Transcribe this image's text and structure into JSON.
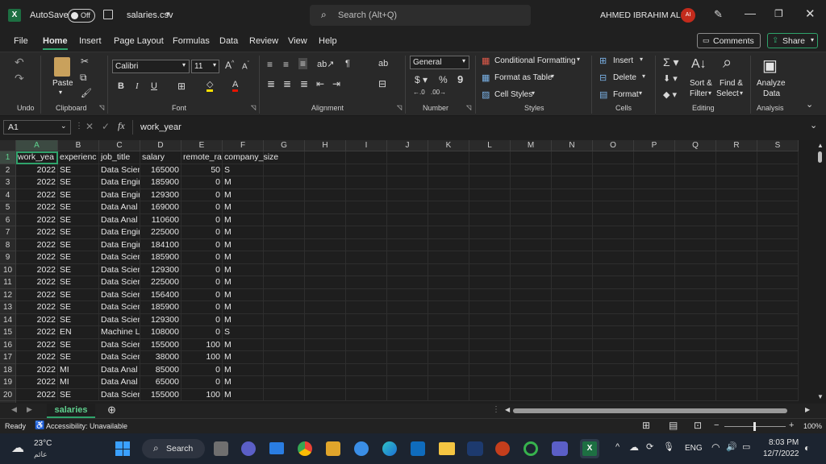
{
  "titlebar": {
    "autosave_label": "AutoSave",
    "autosave_state": "Off",
    "filename": "salaries.csv",
    "search_placeholder": "Search (Alt+Q)",
    "user_name": "AHMED IBRAHIM ALI",
    "user_initials": "AI"
  },
  "menu": {
    "items": [
      "File",
      "Home",
      "Insert",
      "Page Layout",
      "Formulas",
      "Data",
      "Review",
      "View",
      "Help"
    ],
    "comments": "Comments",
    "share": "Share"
  },
  "ribbon": {
    "undo": "Undo",
    "clipboard": "Clipboard",
    "paste": "Paste",
    "font_name": "Calibri",
    "font_size": "11",
    "font": "Font",
    "alignment": "Alignment",
    "number_format": "General",
    "number": "Number",
    "cond_format": "Conditional Formatting",
    "format_table": "Format as Table",
    "cell_styles": "Cell Styles",
    "styles": "Styles",
    "insert": "Insert",
    "delete": "Delete",
    "format": "Format",
    "cells": "Cells",
    "sort_filter_1": "Sort &",
    "sort_filter_2": "Filter",
    "find_select_1": "Find &",
    "find_select_2": "Select",
    "editing": "Editing",
    "analyze_1": "Analyze",
    "analyze_2": "Data",
    "analysis": "Analysis"
  },
  "formula": {
    "namebox": "A1",
    "content": "work_year"
  },
  "columns": [
    "A",
    "B",
    "C",
    "D",
    "E",
    "F",
    "G",
    "H",
    "I",
    "J",
    "K",
    "L",
    "M",
    "N",
    "O",
    "P",
    "Q",
    "R",
    "S"
  ],
  "rows": [
    [
      "work_yea",
      "experienc",
      "job_title",
      "salary",
      "remote_ra",
      "company_size"
    ],
    [
      "2022",
      "SE",
      "Data Scien",
      "165000",
      "50",
      "S"
    ],
    [
      "2022",
      "SE",
      "Data Engir",
      "185900",
      "0",
      "M"
    ],
    [
      "2022",
      "SE",
      "Data Engir",
      "129300",
      "0",
      "M"
    ],
    [
      "2022",
      "SE",
      "Data Anal",
      "169000",
      "0",
      "M"
    ],
    [
      "2022",
      "SE",
      "Data Anal",
      "110600",
      "0",
      "M"
    ],
    [
      "2022",
      "SE",
      "Data Engir",
      "225000",
      "0",
      "M"
    ],
    [
      "2022",
      "SE",
      "Data Engir",
      "184100",
      "0",
      "M"
    ],
    [
      "2022",
      "SE",
      "Data Scien",
      "185900",
      "0",
      "M"
    ],
    [
      "2022",
      "SE",
      "Data Scien",
      "129300",
      "0",
      "M"
    ],
    [
      "2022",
      "SE",
      "Data Scien",
      "225000",
      "0",
      "M"
    ],
    [
      "2022",
      "SE",
      "Data Scien",
      "156400",
      "0",
      "M"
    ],
    [
      "2022",
      "SE",
      "Data Scien",
      "185900",
      "0",
      "M"
    ],
    [
      "2022",
      "SE",
      "Data Scien",
      "129300",
      "0",
      "M"
    ],
    [
      "2022",
      "EN",
      "Machine L",
      "108000",
      "0",
      "S"
    ],
    [
      "2022",
      "SE",
      "Data Scien",
      "155000",
      "100",
      "M"
    ],
    [
      "2022",
      "SE",
      "Data Scien",
      "38000",
      "100",
      "M"
    ],
    [
      "2022",
      "MI",
      "Data Anal",
      "85000",
      "0",
      "M"
    ],
    [
      "2022",
      "MI",
      "Data Anal",
      "65000",
      "0",
      "M"
    ],
    [
      "2022",
      "SE",
      "Data Scien",
      "155000",
      "100",
      "M"
    ]
  ],
  "sheet_tab": "salaries",
  "status": {
    "ready": "Ready",
    "accessibility": "Accessibility: Unavailable",
    "zoom": "100%"
  },
  "taskbar": {
    "weather_temp": "23°C",
    "weather_text": "عائم",
    "search": "Search",
    "lang": "ENG",
    "time": "8:03 PM",
    "date": "12/7/2022"
  },
  "colors": {
    "accent": "#2fa36b",
    "excel_green": "#1d6f42",
    "avatar": "#c42b1c"
  }
}
